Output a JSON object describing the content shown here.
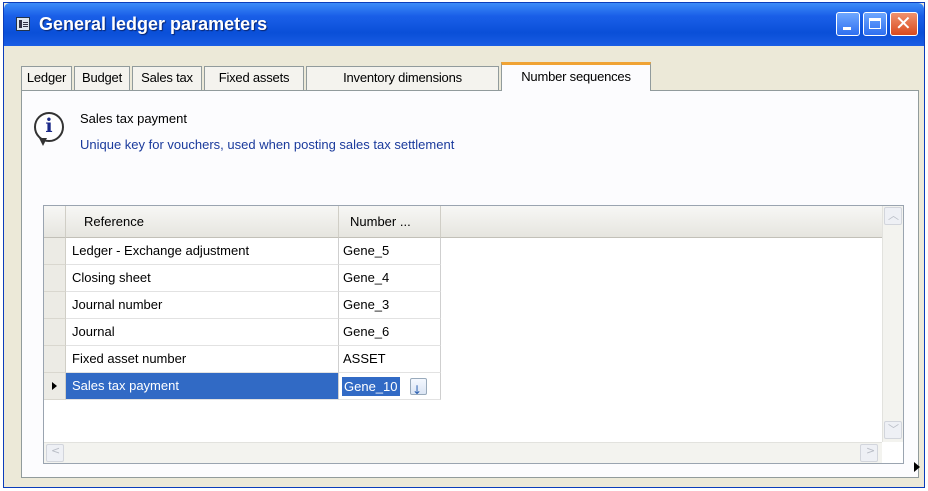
{
  "window": {
    "title": "General ledger parameters",
    "icon": "ledger-app-icon",
    "controls": [
      "minimize-icon",
      "maximize-icon",
      "close-icon"
    ]
  },
  "tabs": [
    {
      "label": "Ledger"
    },
    {
      "label": "Budget"
    },
    {
      "label": "Sales tax"
    },
    {
      "label": "Fixed assets"
    },
    {
      "label": "Inventory dimensions"
    },
    {
      "label": "Number sequences",
      "active": true
    }
  ],
  "info": {
    "icon": "info-icon",
    "title": "Sales tax payment",
    "description": "Unique key for vouchers, used when posting sales tax settlement"
  },
  "grid": {
    "columns": [
      "Reference",
      "Number ..."
    ],
    "rows": [
      {
        "reference": "Ledger - Exchange adjustment",
        "number": "Gene_5"
      },
      {
        "reference": "Closing sheet",
        "number": "Gene_4"
      },
      {
        "reference": "Journal number",
        "number": "Gene_3"
      },
      {
        "reference": "Journal",
        "number": "Gene_6"
      },
      {
        "reference": "Fixed asset number",
        "number": "ASSET"
      },
      {
        "reference": "Sales tax payment",
        "number": "Gene_10",
        "selected": true
      }
    ]
  },
  "colors": {
    "title_bar": "#0a4fd8",
    "active_tab_accent": "#f0a334",
    "selection": "#316ac5",
    "info_text": "#1a3a9c"
  }
}
